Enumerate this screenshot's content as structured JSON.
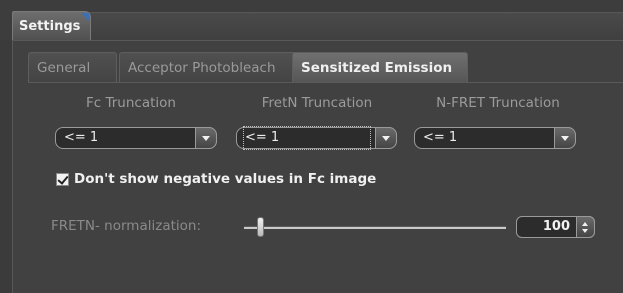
{
  "window": {
    "tab_label": "Settings"
  },
  "tabs": [
    {
      "label": "General"
    },
    {
      "label": "Acceptor Photobleach"
    },
    {
      "label": "Sensitized Emission"
    }
  ],
  "columns": [
    {
      "label": "Fc Truncation",
      "value": "<= 1"
    },
    {
      "label": "FretN Truncation",
      "value": "<= 1"
    },
    {
      "label": "N-FRET Truncation",
      "value": "<= 1"
    }
  ],
  "checkbox": {
    "label": "Don't show negative values in Fc image",
    "checked": true
  },
  "normalization": {
    "label": "FRETN- normalization:",
    "value": "100"
  },
  "colors": {
    "accent": "#3c6fb4"
  }
}
